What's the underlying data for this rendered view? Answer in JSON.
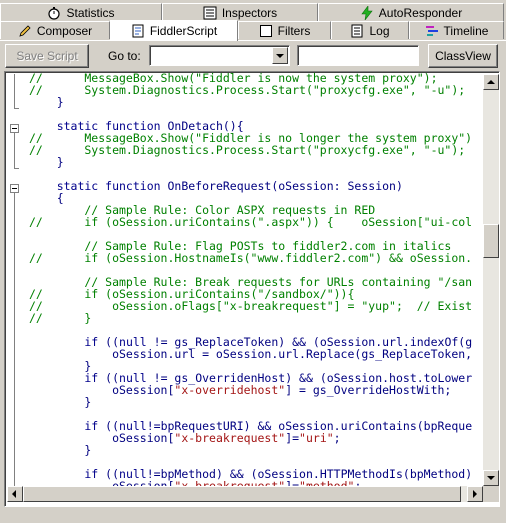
{
  "tabs_row1": [
    {
      "label": "Statistics",
      "icon": "stopwatch-icon"
    },
    {
      "label": "Inspectors",
      "icon": "inspectors-icon"
    },
    {
      "label": "AutoResponder",
      "icon": "lightning-icon"
    }
  ],
  "tabs_row2": [
    {
      "label": "Composer",
      "icon": "pencil-icon"
    },
    {
      "label": "FiddlerScript",
      "icon": "script-icon"
    },
    {
      "label": "Filters",
      "icon": "checkbox-icon"
    },
    {
      "label": "Log",
      "icon": "log-icon"
    },
    {
      "label": "Timeline",
      "icon": "timeline-icon"
    }
  ],
  "toolbar": {
    "save_label": "Save Script",
    "goto_label": "Go to:",
    "goto_value": "",
    "search_value": "",
    "classview_label": "ClassView"
  },
  "code_lines": [
    {
      "parts": [
        [
          "cm",
          "//      MessageBox.Show(\"Fiddler is now the system proxy\");"
        ]
      ]
    },
    {
      "parts": [
        [
          "cm",
          "//      System.Diagnostics.Process.Start(\"proxycfg.exe\", \"-u\");"
        ]
      ]
    },
    {
      "parts": [
        [
          "pl",
          "    }"
        ]
      ]
    },
    {
      "parts": []
    },
    {
      "parts": [
        [
          "kw",
          "    static function "
        ],
        [
          "pl",
          "OnDetach(){"
        ]
      ]
    },
    {
      "parts": [
        [
          "cm",
          "//      MessageBox.Show(\"Fiddler is no longer the system proxy\")"
        ]
      ]
    },
    {
      "parts": [
        [
          "cm",
          "//      System.Diagnostics.Process.Start(\"proxycfg.exe\", \"-u\");"
        ]
      ]
    },
    {
      "parts": [
        [
          "pl",
          "    }"
        ]
      ]
    },
    {
      "parts": []
    },
    {
      "parts": [
        [
          "kw",
          "    static function "
        ],
        [
          "pl",
          "OnBeforeRequest(oSession: Session)"
        ]
      ]
    },
    {
      "parts": [
        [
          "pl",
          "    {"
        ]
      ]
    },
    {
      "parts": [
        [
          "cm",
          "        // Sample Rule: Color ASPX requests in RED"
        ]
      ]
    },
    {
      "parts": [
        [
          "cm",
          "//      if (oSession.uriContains(\".aspx\")) {    oSession[\"ui-col"
        ]
      ]
    },
    {
      "parts": []
    },
    {
      "parts": [
        [
          "cm",
          "        // Sample Rule: Flag POSTs to fiddler2.com in italics"
        ]
      ]
    },
    {
      "parts": [
        [
          "cm",
          "//      if (oSession.HostnameIs(\"www.fiddler2.com\") && oSession."
        ]
      ]
    },
    {
      "parts": []
    },
    {
      "parts": [
        [
          "cm",
          "        // Sample Rule: Break requests for URLs containing \"/san"
        ]
      ]
    },
    {
      "parts": [
        [
          "cm",
          "//      if (oSession.uriContains(\"/sandbox/\")){"
        ]
      ]
    },
    {
      "parts": [
        [
          "cm",
          "//          oSession.oFlags[\"x-breakrequest\"] = \"yup\";  // Exist"
        ]
      ]
    },
    {
      "parts": [
        [
          "cm",
          "//      }"
        ]
      ]
    },
    {
      "parts": []
    },
    {
      "parts": [
        [
          "kw",
          "        if "
        ],
        [
          "pl",
          "(("
        ],
        [
          "kw",
          "null"
        ],
        [
          "pl",
          " != gs_ReplaceToken) && (oSession.url.indexOf(g"
        ]
      ]
    },
    {
      "parts": [
        [
          "pl",
          "            oSession.url = oSession.url.Replace(gs_ReplaceToken,"
        ]
      ]
    },
    {
      "parts": [
        [
          "pl",
          "        }"
        ]
      ]
    },
    {
      "parts": [
        [
          "kw",
          "        if "
        ],
        [
          "pl",
          "(("
        ],
        [
          "kw",
          "null"
        ],
        [
          "pl",
          " != gs_OverridenHost) && (oSession.host.toLower"
        ]
      ]
    },
    {
      "parts": [
        [
          "pl",
          "            oSession["
        ],
        [
          "st",
          "\"x-overridehost\""
        ],
        [
          "pl",
          "] = gs_OverrideHostWith;"
        ]
      ]
    },
    {
      "parts": [
        [
          "pl",
          "        }"
        ]
      ]
    },
    {
      "parts": []
    },
    {
      "parts": [
        [
          "kw",
          "        if "
        ],
        [
          "pl",
          "(("
        ],
        [
          "kw",
          "null"
        ],
        [
          "pl",
          "!=bpRequestURI) && oSession.uriContains(bpReque"
        ]
      ]
    },
    {
      "parts": [
        [
          "pl",
          "            oSession["
        ],
        [
          "st",
          "\"x-breakrequest\""
        ],
        [
          "pl",
          "]="
        ],
        [
          "st",
          "\"uri\""
        ],
        [
          "pl",
          ";"
        ]
      ]
    },
    {
      "parts": [
        [
          "pl",
          "        }"
        ]
      ]
    },
    {
      "parts": []
    },
    {
      "parts": [
        [
          "kw",
          "        if "
        ],
        [
          "pl",
          "(("
        ],
        [
          "kw",
          "null"
        ],
        [
          "pl",
          "!=bpMethod) && (oSession.HTTPMethodIs(bpMethod)"
        ]
      ]
    },
    {
      "parts": [
        [
          "pl",
          "            oSession["
        ],
        [
          "st",
          "\"x-breakrequest\""
        ],
        [
          "pl",
          "]="
        ],
        [
          "st",
          "\"method\""
        ],
        [
          "pl",
          ";"
        ]
      ]
    },
    {
      "parts": [
        [
          "pl",
          "        }"
        ]
      ]
    }
  ]
}
